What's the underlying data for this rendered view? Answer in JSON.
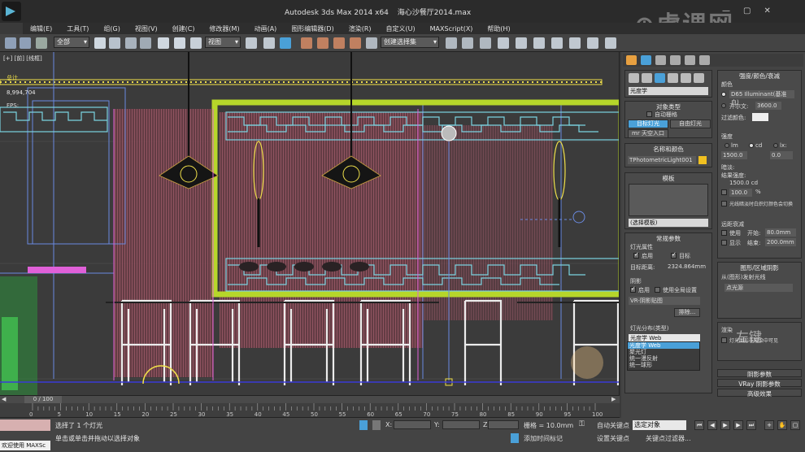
{
  "titlebar": {
    "app": "Autodesk 3ds Max  2014 x64",
    "file": "海心沙餐厅2014.max"
  },
  "menu": [
    "编辑(E)",
    "工具(T)",
    "组(G)",
    "视图(V)",
    "创建(C)",
    "修改器(M)",
    "动画(A)",
    "图形编辑器(D)",
    "渲染(R)",
    "自定义(U)",
    "MAXScript(X)",
    "帮助(H)"
  ],
  "toolbar": {
    "selection_filter": "全部",
    "ref_coord": "视图",
    "named_selection": "创建选择集"
  },
  "viewport": {
    "label": "[+] [前] [线框]",
    "stats_total_label": "总计",
    "stats_value": "8,994,704",
    "fps_label": "FPS:"
  },
  "timeline": {
    "frame_counter": "0 / 100",
    "ticks": [
      "0",
      "5",
      "10",
      "15",
      "20",
      "25",
      "30",
      "35",
      "40",
      "45",
      "50",
      "55",
      "60",
      "65",
      "70",
      "75",
      "80",
      "85",
      "90",
      "95",
      "100"
    ]
  },
  "status": {
    "listener": "欢迎使用 MAXSc",
    "line1": "选择了 1 个灯光",
    "line2": "单击或单击并拖动以选择对象",
    "x_label": "X:",
    "y_label": "Y:",
    "z_label": "Z:",
    "grid": "栅格 = 10.0mm",
    "add_time_tag": "添加时间标记",
    "auto_key": "自动关键点",
    "set_key": "设置关键点",
    "selected_object": "选定对象",
    "key_filter": "关键点过滤器..."
  },
  "watermark": "虎课网",
  "cmd": {
    "category": "光度学",
    "object_type_title": "对象类型",
    "auto_grid": "自动栅格",
    "btn_target_light": "目标灯光",
    "btn_free_light": "自由灯光",
    "btn_skylight": "mr 天空入口",
    "name_color_title": "名称和颜色",
    "object_name": "TPhotometricLight001",
    "template_title": "模板",
    "template_select": "(选择模板)",
    "general_title": "常规参数",
    "light_props": "灯光属性",
    "enabled": "启用",
    "targeted": "目标",
    "target_dist_label": "目标距离:",
    "target_dist_value": "2324.864mm",
    "shadows": "阴影",
    "shadow_enabled": "启用",
    "use_global": "使用全局设置",
    "shadow_type": "VR-阴影贴图",
    "exclude": "排除...",
    "distribution_label": "灯光分布(类型)",
    "distribution_value": "光度学 Web",
    "distribution_options": [
      "光度学 Web",
      "聚光灯",
      "统一漫反射",
      "统一球形"
    ],
    "intensity_title": "强度/颜色/衰减",
    "color_label": "颜色",
    "color_preset": "D65 Illuminant(基准白)",
    "kelvin_label": "开尔文:",
    "kelvin_value": "3600.0",
    "filter_color": "过滤颜色:",
    "intensity_label": "强度",
    "unit_lm": "lm",
    "unit_cd": "cd",
    "unit_lx": "lx:",
    "intensity_value": "1500.0",
    "intensity_value2": "0.0",
    "dim_label": "暗淡:",
    "result_label": "结果强度:",
    "result_value": "1500.0 cd",
    "dim_percent": "100.0",
    "percent": "%",
    "incandescent": "光线暗淡时白炽灯颜色会切换",
    "far_atten": "远距衰减",
    "use": "使用",
    "start_label": "开始:",
    "start_value": "80.0mm",
    "show": "显示",
    "end_label": "结束:",
    "end_value": "200.0mm",
    "shape_title": "图形/区域阴影",
    "emit_from": "从(图形)发射光线",
    "shape_value": "点光源",
    "render_label": "渲染",
    "visible": "灯光图形在渲染中可见",
    "shadow_params": "阴影参数",
    "vray_shadow": "VRay 阴影参数",
    "advanced": "高级效果"
  },
  "overlay": {
    "left_key": "左键"
  },
  "colors": {
    "accent": "#4aa0d8",
    "curtain": "#8a4a58",
    "lime": "#b6d62a",
    "cyan": "#7ad3e0",
    "yellow": "#f0e04a"
  }
}
